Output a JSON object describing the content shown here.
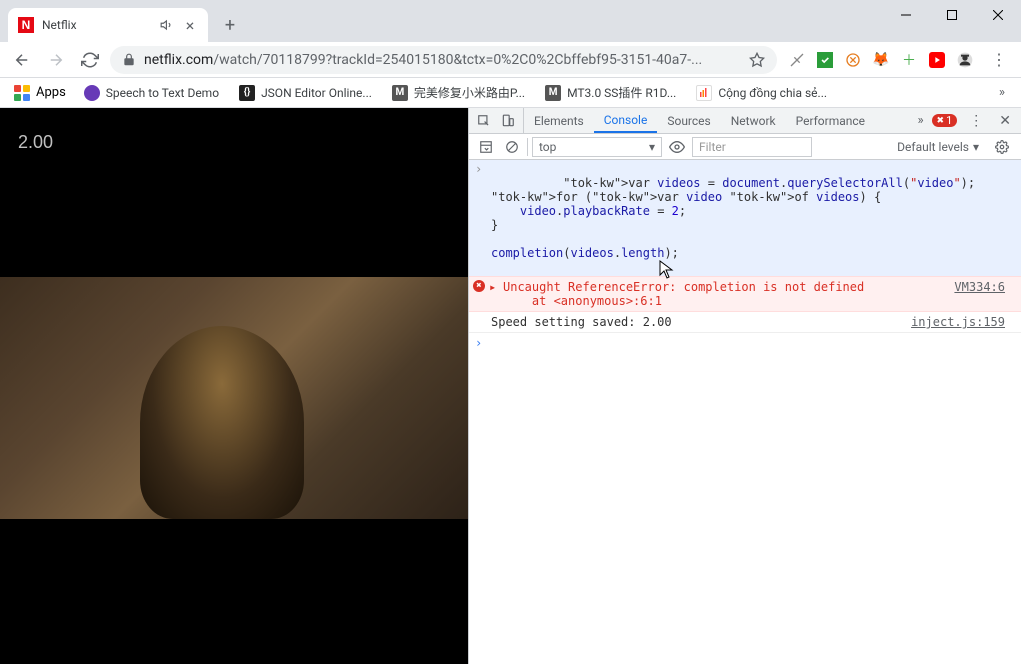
{
  "tab": {
    "title": "Netflix",
    "favicon_letter": "N",
    "favicon_bg": "#e50914"
  },
  "url": {
    "host": "netflix.com",
    "path": "/watch/70118799?trackId=254015180&tctx=0%2C0%2Cbffebf95-3151-40a7-..."
  },
  "bookmarks": {
    "apps_label": "Apps",
    "items": [
      {
        "label": "Speech to Text Demo",
        "icon_bg": "#673ab7",
        "icon_text": ""
      },
      {
        "label": "JSON Editor Online...",
        "icon_bg": "#222",
        "icon_text": "{}"
      },
      {
        "label": "完美修复小米路由P...",
        "icon_bg": "#555",
        "icon_text": "M"
      },
      {
        "label": "MT3.0 SS插件 R1D...",
        "icon_bg": "#555",
        "icon_text": "M"
      },
      {
        "label": "Cộng đồng chia sẻ...",
        "icon_bg": "#fff",
        "icon_text": ""
      }
    ]
  },
  "video": {
    "speed_overlay": "2.00"
  },
  "devtools": {
    "tabs": [
      "Elements",
      "Console",
      "Sources",
      "Network",
      "Performance"
    ],
    "active_tab": "Console",
    "error_count": "1",
    "context": "top",
    "filter_placeholder": "Filter",
    "levels": "Default levels",
    "console": {
      "code_lines": [
        "var videos = document.querySelectorAll(\"video\");",
        "for (var video of videos) {",
        "    video.playbackRate = 2;",
        "}",
        "",
        "completion(videos.length);"
      ],
      "error_text": "Uncaught ReferenceError: completion is not defined\n    at <anonymous>:6:1",
      "error_link": "VM334:6",
      "log_text": "Speed setting saved: 2.00",
      "log_link": "inject.js:159"
    }
  }
}
